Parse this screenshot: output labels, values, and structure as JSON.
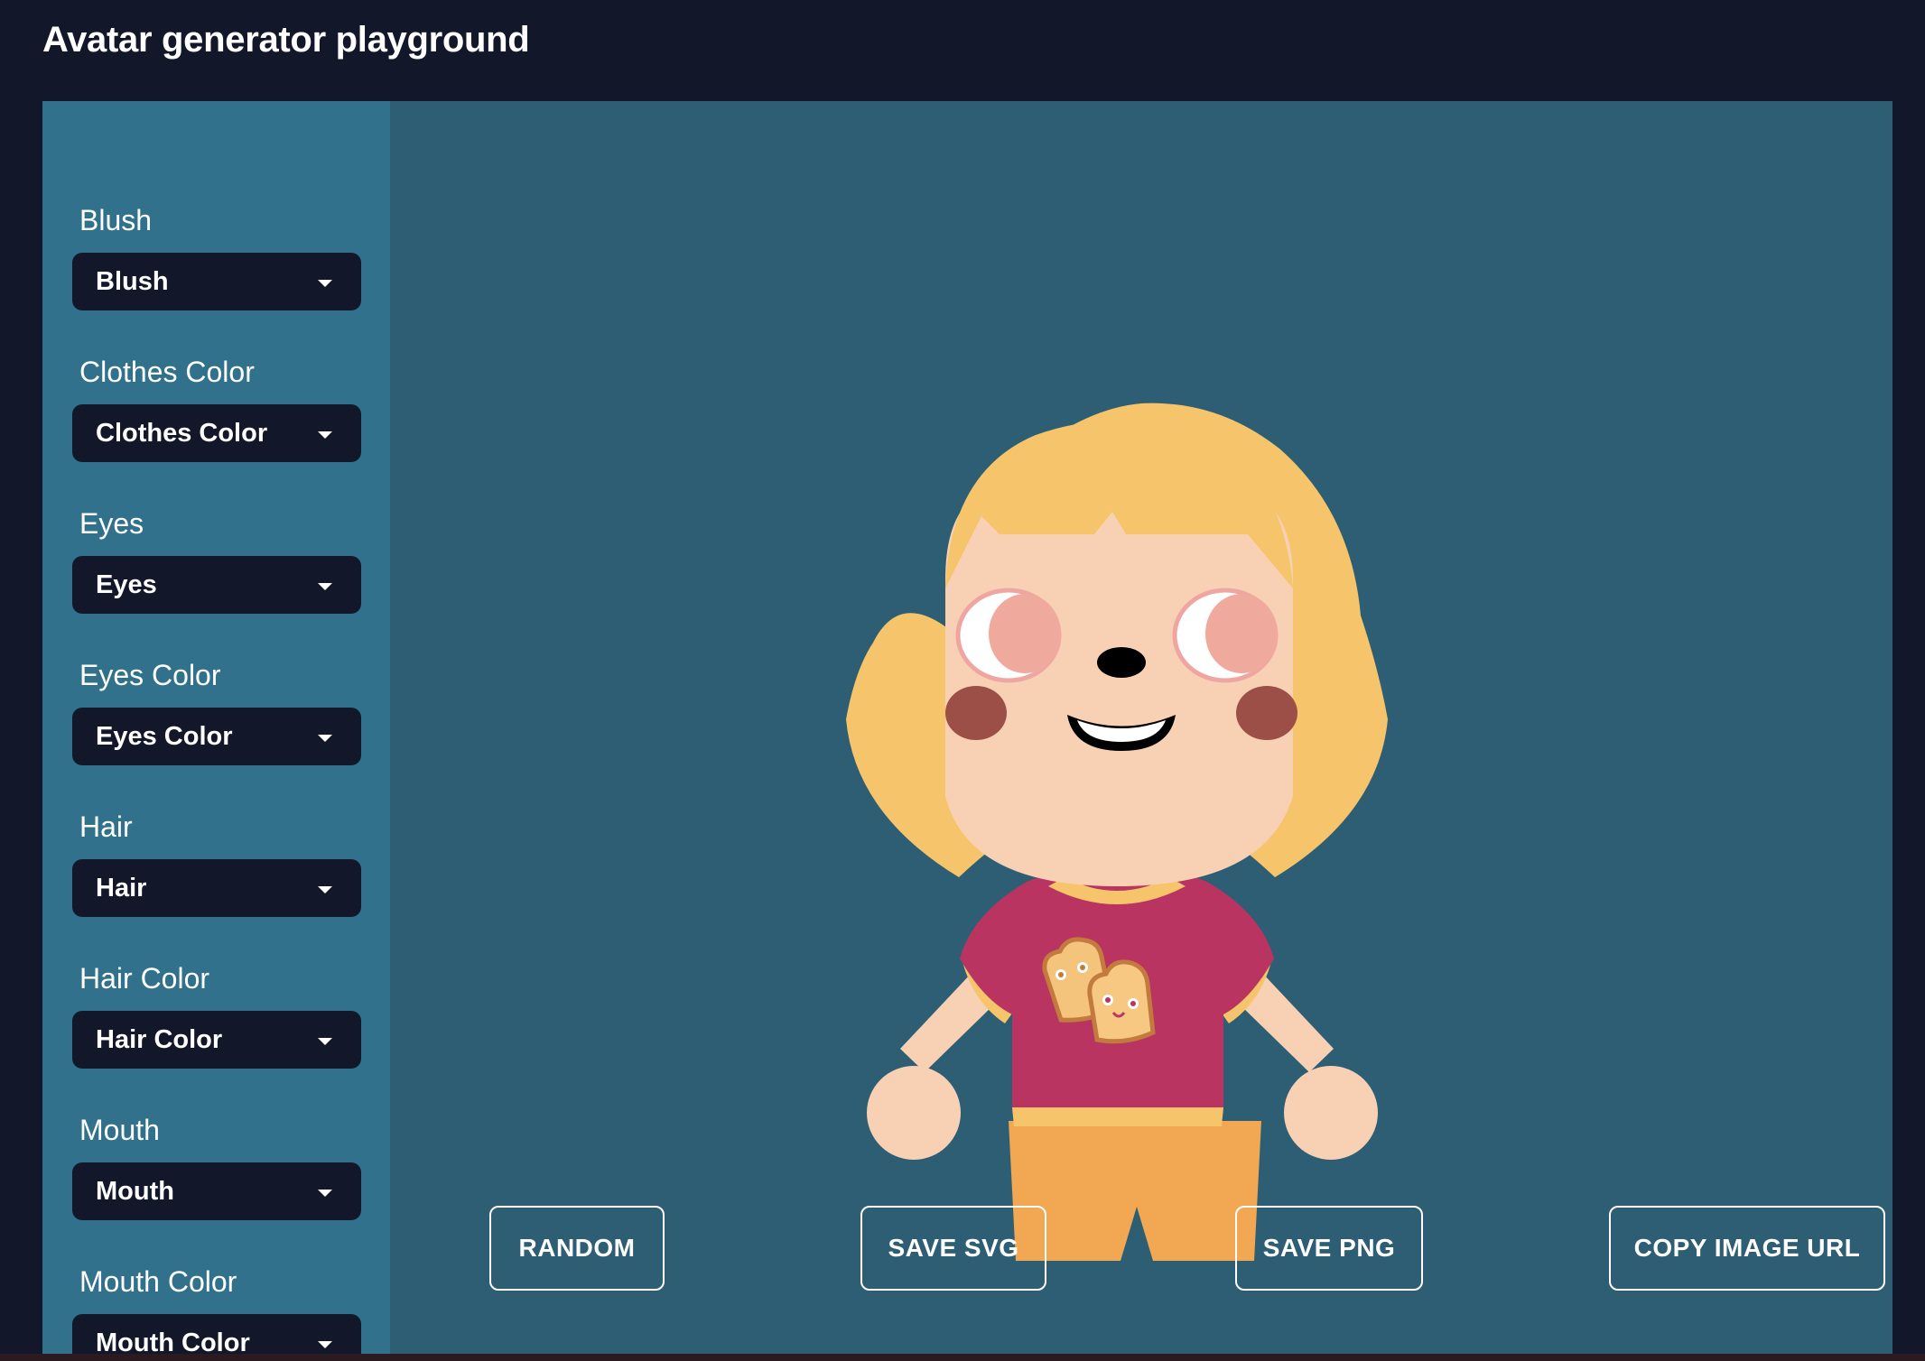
{
  "app": {
    "title": "Avatar generator playground"
  },
  "controls": [
    {
      "label": "Blush",
      "value": "Blush"
    },
    {
      "label": "Clothes Color",
      "value": "Clothes Color"
    },
    {
      "label": "Eyes",
      "value": "Eyes"
    },
    {
      "label": "Eyes Color",
      "value": "Eyes Color"
    },
    {
      "label": "Hair",
      "value": "Hair"
    },
    {
      "label": "Hair Color",
      "value": "Hair Color"
    },
    {
      "label": "Mouth",
      "value": "Mouth"
    },
    {
      "label": "Mouth Color",
      "value": "Mouth Color"
    }
  ],
  "actions": {
    "random": "RANDOM",
    "save_svg": "SAVE SVG",
    "save_png": "SAVE PNG",
    "copy_url": "COPY IMAGE URL"
  },
  "colors": {
    "page_bg": "#12172a",
    "sidebar_bg": "#31718c",
    "stage_bg": "#2d5e73",
    "hair": "#f6c46a",
    "skin": "#f8d1b5",
    "shirt": "#b93461",
    "pants": "#f2a852",
    "blush": "#9c4f46"
  }
}
